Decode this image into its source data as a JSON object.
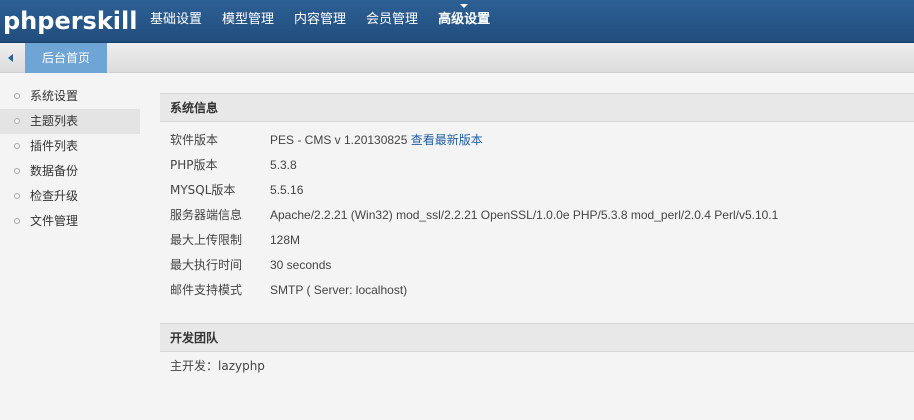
{
  "header": {
    "logo": "phperskill",
    "nav": [
      {
        "label": "基础设置"
      },
      {
        "label": "模型管理"
      },
      {
        "label": "内容管理"
      },
      {
        "label": "会员管理"
      },
      {
        "label": "高级设置"
      }
    ],
    "active_nav": "高级设置"
  },
  "tabs": {
    "home_label": "后台首页"
  },
  "sidebar": {
    "items": [
      {
        "label": "系统设置"
      },
      {
        "label": "主题列表"
      },
      {
        "label": "插件列表"
      },
      {
        "label": "数据备份"
      },
      {
        "label": "检查升级"
      },
      {
        "label": "文件管理"
      }
    ],
    "active_item": "主题列表"
  },
  "system_info": {
    "title": "系统信息",
    "rows": [
      {
        "label": "软件版本",
        "value": "PES - CMS v 1.20130825",
        "link": "查看最新版本"
      },
      {
        "label": "PHP版本",
        "value": "5.3.8"
      },
      {
        "label": "MYSQL版本",
        "value": "5.5.16"
      },
      {
        "label": "服务器端信息",
        "value": "Apache/2.2.21 (Win32) mod_ssl/2.2.21 OpenSSL/1.0.0e PHP/5.3.8 mod_perl/2.0.4 Perl/v5.10.1"
      },
      {
        "label": "最大上传限制",
        "value": "128M"
      },
      {
        "label": "最大执行时间",
        "value": "30 seconds"
      },
      {
        "label": "邮件支持模式",
        "value": "SMTP ( Server: localhost)"
      }
    ]
  },
  "dev_team": {
    "title": "开发团队",
    "line": "主开发：lazyphp"
  },
  "colors": {
    "header_bg": "#26568a",
    "tab_active_bg": "#6ea5d5",
    "link": "#1f5fa6"
  }
}
